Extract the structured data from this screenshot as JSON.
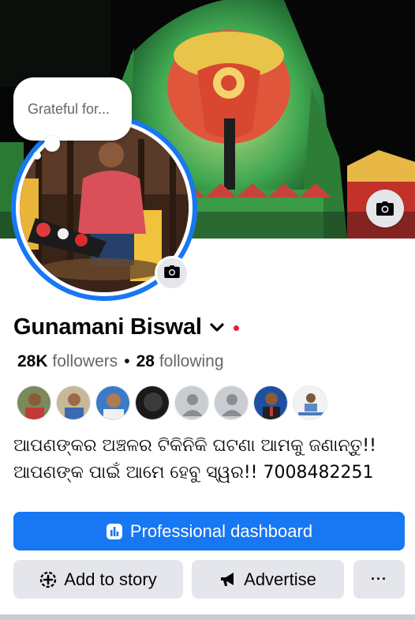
{
  "cover": {
    "icon": "camera-icon"
  },
  "profile": {
    "note": "Grateful for...",
    "avatar_camera_icon": "camera-icon",
    "name": "Gunamani Biswal",
    "name_dropdown_icon": "chevron-down-icon",
    "followers_count": "28K",
    "followers_label": "followers",
    "separator": "•",
    "following_count": "28",
    "following_label": "following",
    "friends_preview": [
      {
        "icon": "friend-avatar"
      },
      {
        "icon": "friend-avatar"
      },
      {
        "icon": "friend-avatar"
      },
      {
        "icon": "friend-avatar"
      },
      {
        "icon": "default-avatar-icon"
      },
      {
        "icon": "default-avatar-icon"
      },
      {
        "icon": "friend-avatar"
      },
      {
        "icon": "friend-avatar"
      }
    ],
    "bio_line1": "ଆପଣଙ୍କର ଅଞ୍ଚଳର ଟିକିନିକି ଘଟଣା ଆମକୁ ଜଣାନ୍ତୁ!!",
    "bio_line2": "ଆପଣଙ୍କ ପାଇଁ ଆମେ ହେବୁ ସ୍ୱର!!  7008482251"
  },
  "actions": {
    "dashboard_label": "Professional dashboard",
    "dashboard_icon": "dashboard-icon",
    "story_label": "Add to story",
    "story_icon": "plus-circle-icon",
    "advertise_label": "Advertise",
    "advertise_icon": "megaphone-icon",
    "more_label": "···"
  },
  "colors": {
    "primary": "#1877f2",
    "button_gray": "#e4e6eb",
    "secondary_text": "#65676b",
    "status_dot": "#e41e3f"
  }
}
